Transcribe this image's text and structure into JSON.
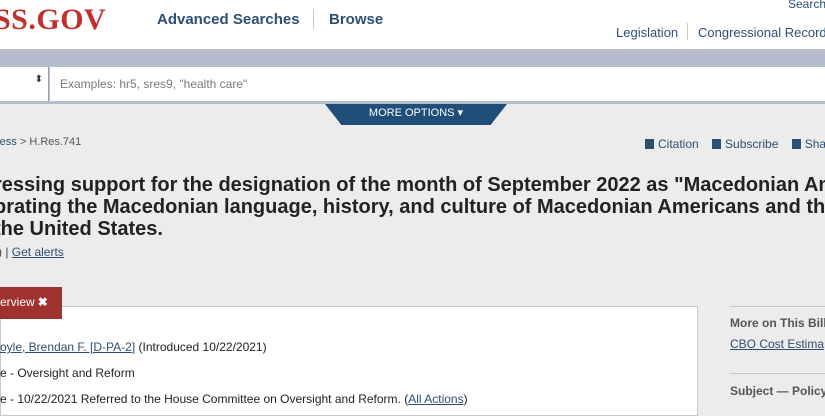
{
  "header": {
    "logo_text": "SS.GOV",
    "nav": [
      "Advanced Searches",
      "Browse"
    ],
    "top_search_link": "Search",
    "links": [
      "Legislation",
      "Congressional Record"
    ]
  },
  "search": {
    "placeholder": "Examples: hr5, sres9, \"health care\"",
    "value": "",
    "scope_arrow": "⬍"
  },
  "more_options": "MORE OPTIONS ▾",
  "breadcrumb": {
    "link": "ress",
    "rest": " > H.Res.741"
  },
  "tools": [
    "Citation",
    "Subscribe",
    "Sha"
  ],
  "bill": {
    "title_lines": [
      "ressing support for the designation of the month of September 2022 as \"Macedonian Am",
      "brating the Macedonian language, history, and culture of Macedonian Americans and th",
      " the United States."
    ],
    "subrow_prefix": ") | ",
    "get_alerts": "Get alerts"
  },
  "overview": {
    "tab_label": "erview",
    "tab_close": "✖",
    "sponsor_link": "oyle, Brendan F. [D-PA-2]",
    "sponsor_suffix": " (Introduced 10/22/2021)",
    "committee": "e - Oversight and Reform",
    "latest_action": "e - 10/22/2021 Referred to the House Committee on Oversight and Reform.  (",
    "all_actions": "All Actions",
    "latest_action_close": ")"
  },
  "sidebar": {
    "more_heading": "More on This Bill",
    "cbo_link": "CBO Cost Estima",
    "subject_heading": "Subject — Policy"
  }
}
